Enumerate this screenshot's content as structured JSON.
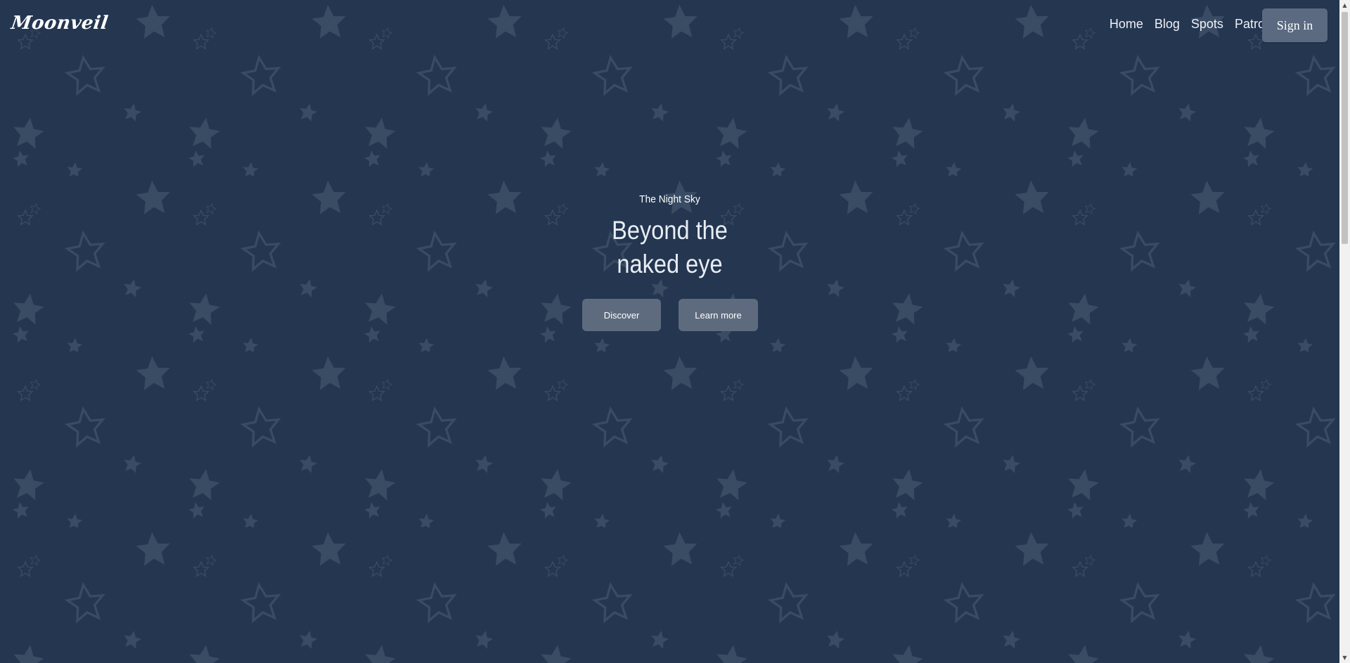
{
  "brand": {
    "logo_text": "Moonveil"
  },
  "nav": {
    "items": [
      {
        "label": "Home"
      },
      {
        "label": "Blog"
      },
      {
        "label": "Spots"
      },
      {
        "label": "Patronship"
      }
    ],
    "sign_in_label": "Sign in"
  },
  "hero": {
    "eyebrow": "The Night Sky",
    "headline_line1": "Beyond the",
    "headline_line2": "naked eye",
    "primary_button": "Discover",
    "secondary_button": "Learn more"
  },
  "colors": {
    "background": "#243650",
    "star_pattern": "#3a4b64",
    "button": "#5e6b7f",
    "sign_in_button": "#5b6a80"
  },
  "icons": {
    "background_pattern": "star-pattern",
    "scroll_up": "chevron-up-icon",
    "scroll_down": "chevron-down-icon"
  }
}
